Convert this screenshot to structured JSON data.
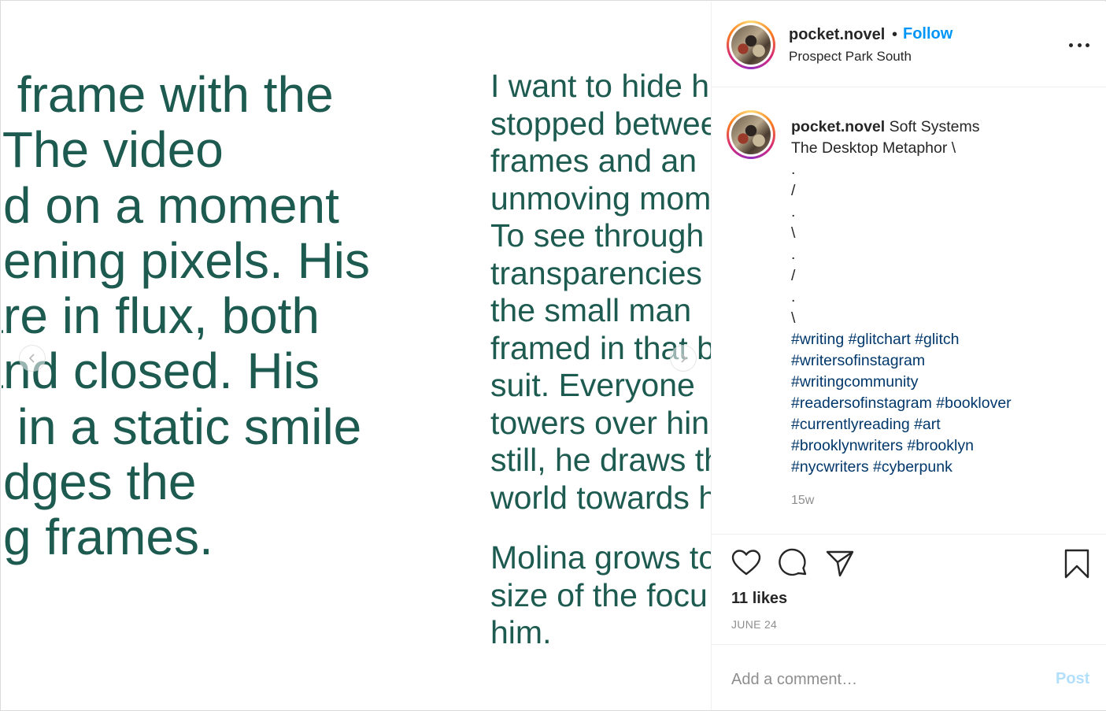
{
  "image": {
    "left_lines": [
      "e frame with the",
      ". The video",
      "ed on a moment",
      "eening pixels. His",
      "are in flux, both",
      "and closed. His",
      "n in a static smile",
      "ridges the",
      "ng frames."
    ],
    "right_paragraph_1": [
      "I want to hide h",
      "stopped betwee",
      "frames and an",
      "unmoving mom",
      "To see through",
      "transparencies",
      "the small man",
      "framed in that b",
      "suit. Everyone",
      "towers over hin",
      "still, he draws th",
      "world towards h"
    ],
    "right_paragraph_2": [
      "Molina grows to",
      "size of the focu",
      "him."
    ],
    "text_color": "#1d5a50",
    "prev_icon": "chevron-left-icon",
    "next_icon": "chevron-right-icon"
  },
  "header": {
    "username": "pocket.novel",
    "separator": "•",
    "follow_label": "Follow",
    "location": "Prospect Park South",
    "more_icon": "more-options-icon"
  },
  "caption": {
    "username": "pocket.novel",
    "lines": [
      "Soft Systems",
      "The Desktop Metaphor \\",
      ".",
      "/",
      ".",
      "\\",
      ".",
      "/",
      ".",
      "\\"
    ],
    "hashtag_lines": [
      "#writing #glitchart #glitch",
      "#writersofinstagram",
      "#writingcommunity",
      "#readersofinstagram #booklover",
      "#currentlyreading #art",
      "#brooklynwriters #brooklyn",
      "#nycwriters #cyberpunk"
    ],
    "time_ago": "15w"
  },
  "actions": {
    "like_icon": "heart-icon",
    "comment_icon": "comment-icon",
    "share_icon": "share-icon",
    "save_icon": "bookmark-icon",
    "likes": "11 likes",
    "date": "JUNE 24"
  },
  "comment": {
    "placeholder": "Add a comment…",
    "post_label": "Post"
  },
  "colors": {
    "link_blue": "#0095f6",
    "hashtag_blue": "#00376b",
    "post_disabled": "#b2dffc",
    "muted": "#8e8e8e"
  }
}
